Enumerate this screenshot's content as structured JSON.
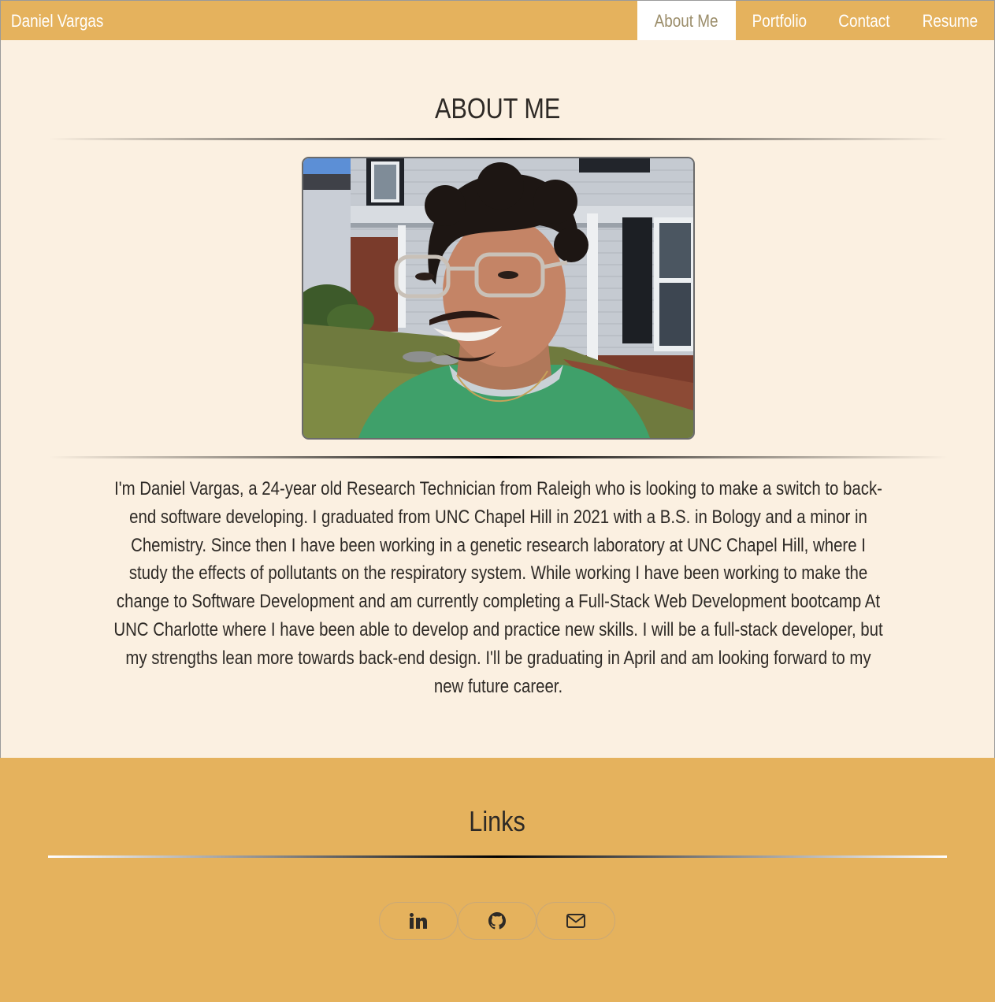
{
  "nav": {
    "brand": "Daniel Vargas",
    "links": [
      {
        "label": "About Me",
        "active": true
      },
      {
        "label": "Portfolio",
        "active": false
      },
      {
        "label": "Contact",
        "active": false
      },
      {
        "label": "Resume",
        "active": false
      }
    ]
  },
  "about": {
    "title": "ABOUT ME",
    "bio": "I'm Daniel Vargas, a 24-year old Research Technician from Raleigh who is looking to make a switch to back-end software developing. I graduated from UNC Chapel Hill in 2021 with a B.S. in Bology and a minor in Chemistry. Since then I have been working in a genetic research laboratory at UNC Chapel Hill, where I study the effects of pollutants on the respiratory system. While working I have been working to make the change to Software Development and am currently completing a Full-Stack Web Development bootcamp At UNC Charlotte where I have been able to develop and practice new skills. I will be a full-stack developer, but my strengths lean more towards back-end design. I'll be graduating in April and am looking forward to my new future career."
  },
  "links": {
    "title": "Links",
    "icons": [
      "linkedin-icon",
      "github-icon",
      "email-icon"
    ]
  },
  "colors": {
    "accent": "#e5b25d",
    "background": "#fbf0e1",
    "text": "#2e2a26"
  }
}
